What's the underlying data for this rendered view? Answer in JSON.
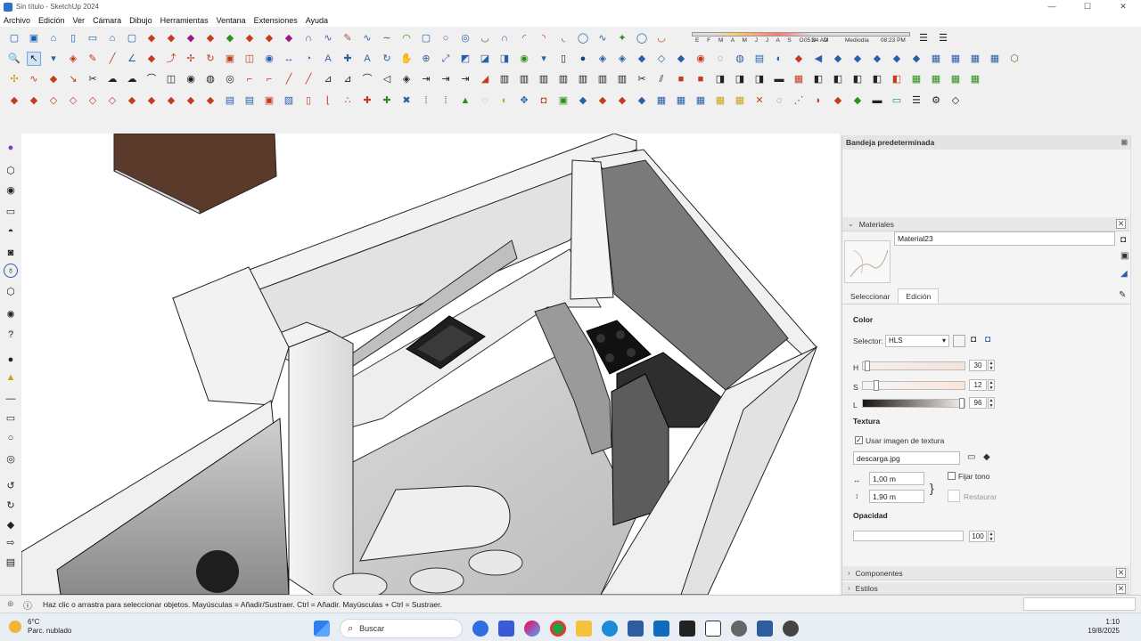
{
  "window": {
    "title": "Sin título - SketchUp 2024",
    "minimize": "—",
    "maximize": "☐",
    "close": "✕"
  },
  "menu": [
    "Archivo",
    "Edición",
    "Ver",
    "Cámara",
    "Dibujo",
    "Herramientas",
    "Ventana",
    "Extensiones",
    "Ayuda"
  ],
  "shadow": {
    "months": "E F M A M J J A S O N D",
    "time_start": "05:24 AM",
    "mid": "Mediodía",
    "time_end": "08:23 PM"
  },
  "tray": {
    "title": "Bandeja predeterminada",
    "materials_header": "Materiales",
    "material_name": "Material23",
    "tab_select": "Seleccionar",
    "tab_edit": "Edición",
    "color_label": "Color",
    "selector_label": "Selector:",
    "selector_value": "HLS",
    "h_label": "H",
    "h_value": "30",
    "s_label": "S",
    "s_value": "12",
    "l_label": "L",
    "l_value": "96",
    "texture_label": "Textura",
    "use_texture_label": "Usar imagen de textura",
    "use_texture_checked": true,
    "texture_file": "descarga.jpg",
    "width_value": "1,00 m",
    "height_value": "1,90 m",
    "fix_tone_label": "Fijar tono",
    "restore_label": "Restaurar",
    "opacity_label": "Opacidad",
    "opacity_value": "100",
    "components_header": "Componentes",
    "styles_header": "Estilos"
  },
  "status": {
    "hint": "Haz clic o arrastra para seleccionar objetos. Mayúsculas = Añadir/Sustraer. Ctrl = Añadir. Mayúsculas + Ctrl = Sustraer."
  },
  "taskbar": {
    "temp": "6°C",
    "weather": "Parc. nublado",
    "search": "Buscar",
    "time": "1:10",
    "date": "19/8/2025"
  }
}
